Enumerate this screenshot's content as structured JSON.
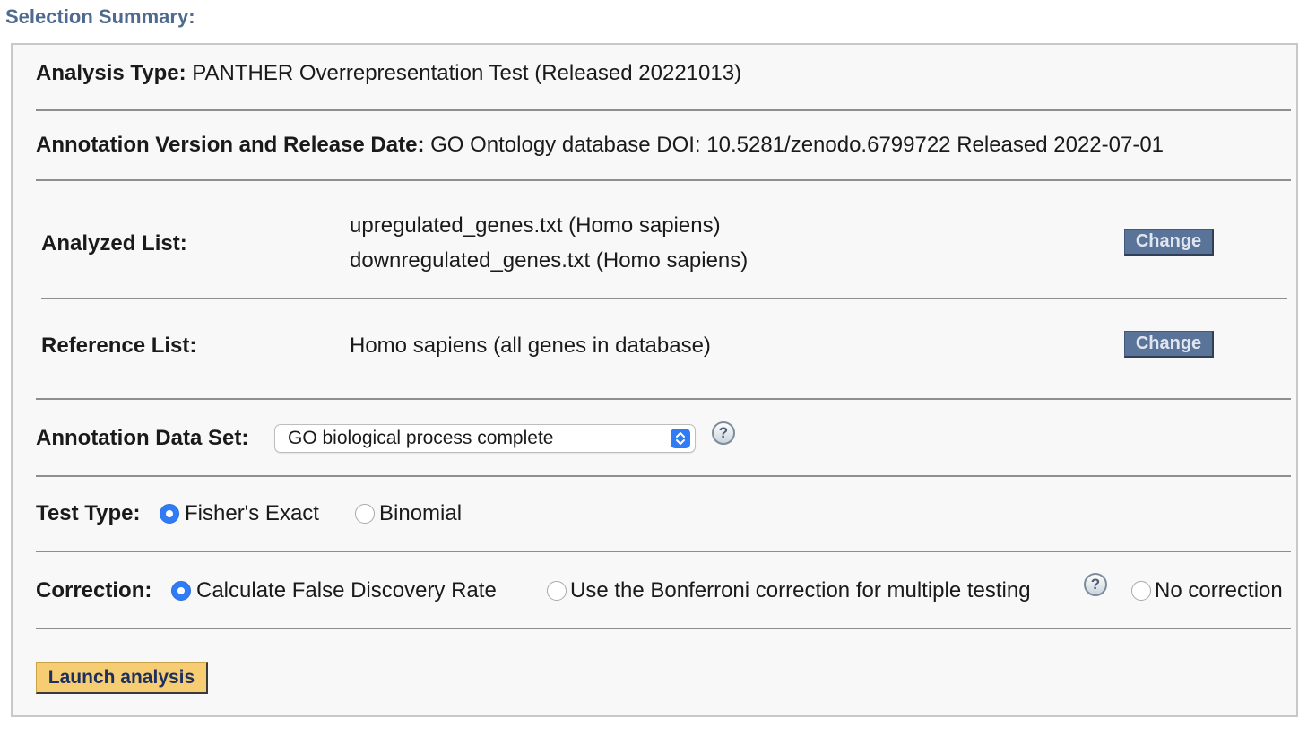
{
  "header": {
    "title": "Selection Summary:"
  },
  "analysis_type": {
    "label": "Analysis Type:",
    "value": "PANTHER Overrepresentation Test (Released 20221013)"
  },
  "annotation_version": {
    "label": "Annotation Version and Release Date:",
    "value": "GO Ontology database DOI:  10.5281/zenodo.6799722 Released 2022-07-01"
  },
  "analyzed_list": {
    "label": "Analyzed List:",
    "files": [
      "upregulated_genes.txt (Homo sapiens)",
      "downregulated_genes.txt (Homo sapiens)"
    ],
    "button_label": "Change"
  },
  "reference_list": {
    "label": "Reference List:",
    "value": "Homo sapiens (all genes in database)",
    "button_label": "Change"
  },
  "annotation_data_set": {
    "label": "Annotation Data Set:",
    "selected": "GO biological process complete",
    "help": "?"
  },
  "test_type": {
    "label": "Test Type:",
    "options": [
      {
        "label": "Fisher's Exact",
        "selected": true
      },
      {
        "label": "Binomial",
        "selected": false
      }
    ]
  },
  "correction": {
    "label": "Correction:",
    "options": [
      {
        "label": "Calculate False Discovery Rate",
        "selected": true
      },
      {
        "label": "Use the Bonferroni correction for multiple testing",
        "selected": false
      },
      {
        "label": "No correction",
        "selected": false
      }
    ],
    "help": "?"
  },
  "launch": {
    "label": "Launch analysis"
  },
  "colors": {
    "title": "#4f6a8f",
    "change_button": "#5a7399",
    "launch_button": "#f7cd74",
    "radio_selected": "#2f7cf6"
  }
}
